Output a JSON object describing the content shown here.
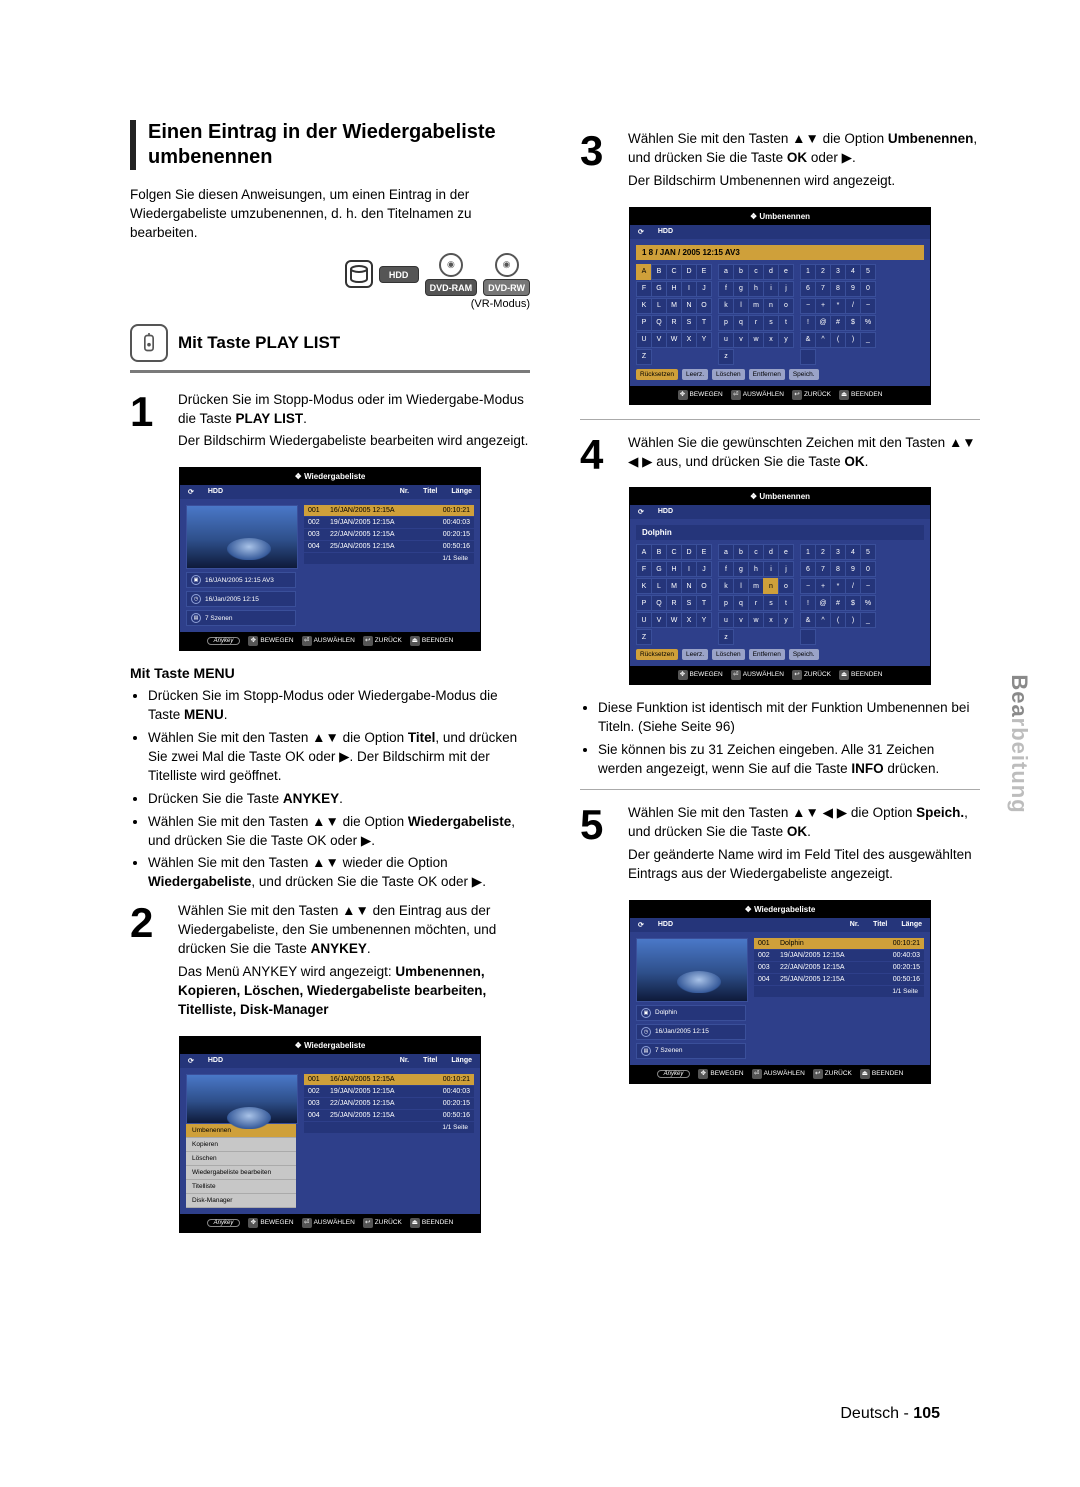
{
  "section": {
    "title": "Einen Eintrag in der Wiedergabeliste umbenennen",
    "intro": "Folgen Sie diesen Anweisungen, um einen Eintrag in der Wiedergabeliste umzubenennen, d. h. den Titelnamen zu bearbeiten.",
    "media_labels": {
      "hdd": "HDD",
      "dvd_ram": "DVD-RAM",
      "dvd_rw": "DVD-RW"
    },
    "vr_modus": "(VR-Modus)",
    "subhead": "Mit Taste PLAY LIST"
  },
  "steps": {
    "s1": {
      "num": "1",
      "p1": "Drücken Sie im Stopp-Modus oder im Wiedergabe-Modus die Taste ",
      "p1_strong": "PLAY LIST",
      "p1_end": ".",
      "p2": "Der Bildschirm Wiedergabeliste bearbeiten wird angezeigt."
    },
    "menu_sub": "Mit Taste MENU",
    "menu_bullets": [
      {
        "pre": "Drücken Sie im Stopp-Modus oder Wiedergabe-Modus die Taste ",
        "strong": "MENU",
        "post": "."
      },
      {
        "pre": "Wählen Sie mit den Tasten ▲▼ die Option ",
        "strong": "Titel",
        "post": ", und drücken Sie zwei Mal die Taste OK oder ▶. Der Bildschirm mit der Titelliste wird geöffnet."
      },
      {
        "pre": "Drücken Sie die Taste ",
        "strong": "ANYKEY",
        "post": "."
      },
      {
        "pre": "Wählen Sie mit den Tasten ▲▼ die Option ",
        "strong": "Wiedergabeliste",
        "post": ", und drücken Sie die Taste OK oder ▶."
      },
      {
        "pre": "Wählen Sie mit den Tasten ▲▼ wieder die Option ",
        "strong": "Wiedergabeliste",
        "post": ", und drücken Sie die Taste OK oder ▶."
      }
    ],
    "s2": {
      "num": "2",
      "p1_a": "Wählen Sie mit den Tasten ▲▼ den Eintrag aus der Wiedergabeliste, den Sie umbenennen möchten, und drücken Sie die Taste ",
      "p1_strong": "ANYKEY",
      "p1_b": ".",
      "p2_a": "Das Menü ANYKEY wird angezeigt: ",
      "p2_strong": "Umbenennen, Kopieren, Löschen, Wiedergabeliste bearbeiten, Titelliste, Disk-Manager"
    },
    "s3": {
      "num": "3",
      "p1_a": "Wählen Sie mit den Tasten ▲▼ die Option ",
      "p1_strong": "Umbenennen",
      "p1_b": ", und drücken Sie die Taste ",
      "p1_strong2": "OK",
      "p1_c": " oder ▶.",
      "p2": "Der Bildschirm Umbenennen wird angezeigt."
    },
    "s4": {
      "num": "4",
      "p1_a": "Wählen Sie die gewünschten Zeichen mit den Tasten ▲▼ ◀ ▶ aus, und drücken Sie die Taste ",
      "p1_strong": "OK",
      "p1_b": ".",
      "note1": "Diese Funktion ist identisch mit der Funktion Umbenennen bei Titeln. (Siehe Seite 96)",
      "note2_a": "Sie können bis zu 31 Zeichen eingeben. Alle 31 Zeichen werden angezeigt, wenn Sie auf die Taste ",
      "note2_strong": "INFO",
      "note2_b": " drücken."
    },
    "s5": {
      "num": "5",
      "p1_a": "Wählen Sie mit den Tasten ▲▼ ◀ ▶ die Option ",
      "p1_strong": "Speich.",
      "p1_b": ", und drücken Sie die Taste ",
      "p1_strong2": "OK",
      "p1_c": ".",
      "p2": "Der geänderte Name wird im Feld Titel des ausgewählten Eintrags aus der Wiedergabeliste angezeigt."
    }
  },
  "osd": {
    "playlist_title": "Wiedergabeliste",
    "rename_title": "Umbenennen",
    "hdd": "HDD",
    "headers": {
      "nr": "Nr.",
      "titel": "Titel",
      "laenge": "Länge"
    },
    "rows": [
      {
        "nr": "001",
        "title": "16/JAN/2005 12:15A",
        "len": "00:10:21"
      },
      {
        "nr": "002",
        "title": "19/JAN/2005 12:15A",
        "len": "00:40:03"
      },
      {
        "nr": "003",
        "title": "22/JAN/2005 12:15A",
        "len": "00:20:15"
      },
      {
        "nr": "004",
        "title": "25/JAN/2005 12:15A",
        "len": "00:50:16"
      }
    ],
    "rows_after": [
      {
        "nr": "001",
        "title": "Dolphin",
        "len": "00:10:21"
      },
      {
        "nr": "002",
        "title": "19/JAN/2005 12:15A",
        "len": "00:40:03"
      },
      {
        "nr": "003",
        "title": "22/JAN/2005 12:15A",
        "len": "00:20:15"
      },
      {
        "nr": "004",
        "title": "25/JAN/2005 12:15A",
        "len": "00:50:16"
      }
    ],
    "info": {
      "line1": "16/JAN/2005 12:15 AV3",
      "line1_after": "Dolphin",
      "line2": "16/Jan/2005 12:15",
      "line3": "7 Szenen"
    },
    "page": "1/1 Seite",
    "foot": {
      "anykey": "Anykey",
      "move": "BEWEGEN",
      "select": "AUSWÄHLEN",
      "back": "ZURÜCK",
      "exit": "BEENDEN"
    },
    "ctx": [
      "Umbenennen",
      "Kopieren",
      "Löschen",
      "Wiedergabeliste bearbeiten",
      "Titelliste",
      "Disk-Manager"
    ],
    "name_sample1": "1 8 / JAN / 2005 12:15 AV3",
    "name_sample2": "Dolphin",
    "kb": {
      "upper": [
        "A",
        "B",
        "C",
        "D",
        "E",
        "F",
        "G",
        "H",
        "I",
        "J",
        "K",
        "L",
        "M",
        "N",
        "O",
        "P",
        "Q",
        "R",
        "S",
        "T",
        "U",
        "V",
        "W",
        "X",
        "Y",
        "Z"
      ],
      "lower": [
        "a",
        "b",
        "c",
        "d",
        "e",
        "f",
        "g",
        "h",
        "i",
        "j",
        "k",
        "l",
        "m",
        "n",
        "o",
        "p",
        "q",
        "r",
        "s",
        "t",
        "u",
        "v",
        "w",
        "x",
        "y",
        "z"
      ],
      "nums": [
        "1",
        "2",
        "3",
        "4",
        "5",
        "6",
        "7",
        "8",
        "9",
        "0",
        "−",
        "+",
        "*",
        "/",
        "~",
        "!",
        "@",
        "#",
        "$",
        "%",
        "&",
        "^",
        "(",
        ")",
        "_"
      ],
      "actions": {
        "reset": "Rücksetzen",
        "space": "Leerz.",
        "delete": "Löschen",
        "remove": "Entfernen",
        "save": "Speich."
      }
    }
  },
  "sidetab": "Bearbeitung",
  "footer": {
    "lang": "Deutsch -",
    "page": "105"
  }
}
